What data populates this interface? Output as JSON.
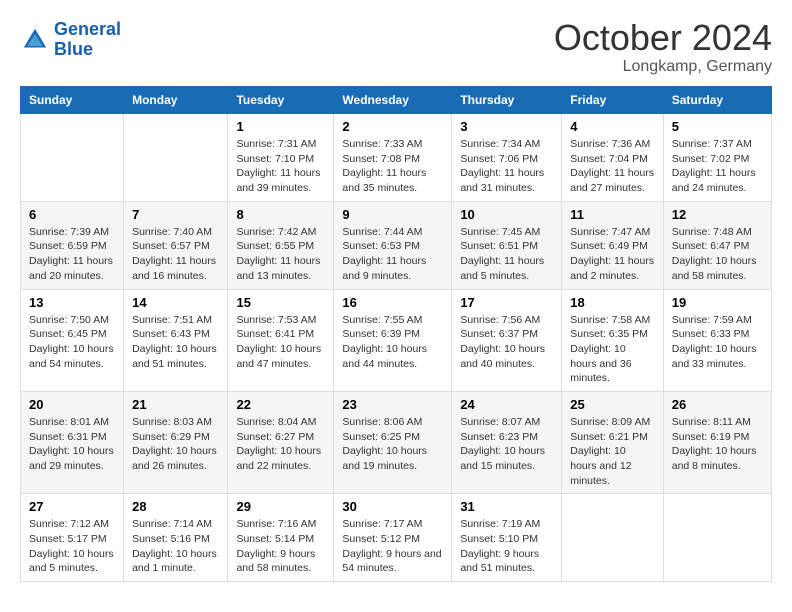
{
  "header": {
    "logo_line1": "General",
    "logo_line2": "Blue",
    "month": "October 2024",
    "location": "Longkamp, Germany"
  },
  "weekdays": [
    "Sunday",
    "Monday",
    "Tuesday",
    "Wednesday",
    "Thursday",
    "Friday",
    "Saturday"
  ],
  "weeks": [
    [
      {
        "day": "",
        "sunrise": "",
        "sunset": "",
        "daylight": ""
      },
      {
        "day": "",
        "sunrise": "",
        "sunset": "",
        "daylight": ""
      },
      {
        "day": "1",
        "sunrise": "Sunrise: 7:31 AM",
        "sunset": "Sunset: 7:10 PM",
        "daylight": "Daylight: 11 hours and 39 minutes."
      },
      {
        "day": "2",
        "sunrise": "Sunrise: 7:33 AM",
        "sunset": "Sunset: 7:08 PM",
        "daylight": "Daylight: 11 hours and 35 minutes."
      },
      {
        "day": "3",
        "sunrise": "Sunrise: 7:34 AM",
        "sunset": "Sunset: 7:06 PM",
        "daylight": "Daylight: 11 hours and 31 minutes."
      },
      {
        "day": "4",
        "sunrise": "Sunrise: 7:36 AM",
        "sunset": "Sunset: 7:04 PM",
        "daylight": "Daylight: 11 hours and 27 minutes."
      },
      {
        "day": "5",
        "sunrise": "Sunrise: 7:37 AM",
        "sunset": "Sunset: 7:02 PM",
        "daylight": "Daylight: 11 hours and 24 minutes."
      }
    ],
    [
      {
        "day": "6",
        "sunrise": "Sunrise: 7:39 AM",
        "sunset": "Sunset: 6:59 PM",
        "daylight": "Daylight: 11 hours and 20 minutes."
      },
      {
        "day": "7",
        "sunrise": "Sunrise: 7:40 AM",
        "sunset": "Sunset: 6:57 PM",
        "daylight": "Daylight: 11 hours and 16 minutes."
      },
      {
        "day": "8",
        "sunrise": "Sunrise: 7:42 AM",
        "sunset": "Sunset: 6:55 PM",
        "daylight": "Daylight: 11 hours and 13 minutes."
      },
      {
        "day": "9",
        "sunrise": "Sunrise: 7:44 AM",
        "sunset": "Sunset: 6:53 PM",
        "daylight": "Daylight: 11 hours and 9 minutes."
      },
      {
        "day": "10",
        "sunrise": "Sunrise: 7:45 AM",
        "sunset": "Sunset: 6:51 PM",
        "daylight": "Daylight: 11 hours and 5 minutes."
      },
      {
        "day": "11",
        "sunrise": "Sunrise: 7:47 AM",
        "sunset": "Sunset: 6:49 PM",
        "daylight": "Daylight: 11 hours and 2 minutes."
      },
      {
        "day": "12",
        "sunrise": "Sunrise: 7:48 AM",
        "sunset": "Sunset: 6:47 PM",
        "daylight": "Daylight: 10 hours and 58 minutes."
      }
    ],
    [
      {
        "day": "13",
        "sunrise": "Sunrise: 7:50 AM",
        "sunset": "Sunset: 6:45 PM",
        "daylight": "Daylight: 10 hours and 54 minutes."
      },
      {
        "day": "14",
        "sunrise": "Sunrise: 7:51 AM",
        "sunset": "Sunset: 6:43 PM",
        "daylight": "Daylight: 10 hours and 51 minutes."
      },
      {
        "day": "15",
        "sunrise": "Sunrise: 7:53 AM",
        "sunset": "Sunset: 6:41 PM",
        "daylight": "Daylight: 10 hours and 47 minutes."
      },
      {
        "day": "16",
        "sunrise": "Sunrise: 7:55 AM",
        "sunset": "Sunset: 6:39 PM",
        "daylight": "Daylight: 10 hours and 44 minutes."
      },
      {
        "day": "17",
        "sunrise": "Sunrise: 7:56 AM",
        "sunset": "Sunset: 6:37 PM",
        "daylight": "Daylight: 10 hours and 40 minutes."
      },
      {
        "day": "18",
        "sunrise": "Sunrise: 7:58 AM",
        "sunset": "Sunset: 6:35 PM",
        "daylight": "Daylight: 10 hours and 36 minutes."
      },
      {
        "day": "19",
        "sunrise": "Sunrise: 7:59 AM",
        "sunset": "Sunset: 6:33 PM",
        "daylight": "Daylight: 10 hours and 33 minutes."
      }
    ],
    [
      {
        "day": "20",
        "sunrise": "Sunrise: 8:01 AM",
        "sunset": "Sunset: 6:31 PM",
        "daylight": "Daylight: 10 hours and 29 minutes."
      },
      {
        "day": "21",
        "sunrise": "Sunrise: 8:03 AM",
        "sunset": "Sunset: 6:29 PM",
        "daylight": "Daylight: 10 hours and 26 minutes."
      },
      {
        "day": "22",
        "sunrise": "Sunrise: 8:04 AM",
        "sunset": "Sunset: 6:27 PM",
        "daylight": "Daylight: 10 hours and 22 minutes."
      },
      {
        "day": "23",
        "sunrise": "Sunrise: 8:06 AM",
        "sunset": "Sunset: 6:25 PM",
        "daylight": "Daylight: 10 hours and 19 minutes."
      },
      {
        "day": "24",
        "sunrise": "Sunrise: 8:07 AM",
        "sunset": "Sunset: 6:23 PM",
        "daylight": "Daylight: 10 hours and 15 minutes."
      },
      {
        "day": "25",
        "sunrise": "Sunrise: 8:09 AM",
        "sunset": "Sunset: 6:21 PM",
        "daylight": "Daylight: 10 hours and 12 minutes."
      },
      {
        "day": "26",
        "sunrise": "Sunrise: 8:11 AM",
        "sunset": "Sunset: 6:19 PM",
        "daylight": "Daylight: 10 hours and 8 minutes."
      }
    ],
    [
      {
        "day": "27",
        "sunrise": "Sunrise: 7:12 AM",
        "sunset": "Sunset: 5:17 PM",
        "daylight": "Daylight: 10 hours and 5 minutes."
      },
      {
        "day": "28",
        "sunrise": "Sunrise: 7:14 AM",
        "sunset": "Sunset: 5:16 PM",
        "daylight": "Daylight: 10 hours and 1 minute."
      },
      {
        "day": "29",
        "sunrise": "Sunrise: 7:16 AM",
        "sunset": "Sunset: 5:14 PM",
        "daylight": "Daylight: 9 hours and 58 minutes."
      },
      {
        "day": "30",
        "sunrise": "Sunrise: 7:17 AM",
        "sunset": "Sunset: 5:12 PM",
        "daylight": "Daylight: 9 hours and 54 minutes."
      },
      {
        "day": "31",
        "sunrise": "Sunrise: 7:19 AM",
        "sunset": "Sunset: 5:10 PM",
        "daylight": "Daylight: 9 hours and 51 minutes."
      },
      {
        "day": "",
        "sunrise": "",
        "sunset": "",
        "daylight": ""
      },
      {
        "day": "",
        "sunrise": "",
        "sunset": "",
        "daylight": ""
      }
    ]
  ]
}
